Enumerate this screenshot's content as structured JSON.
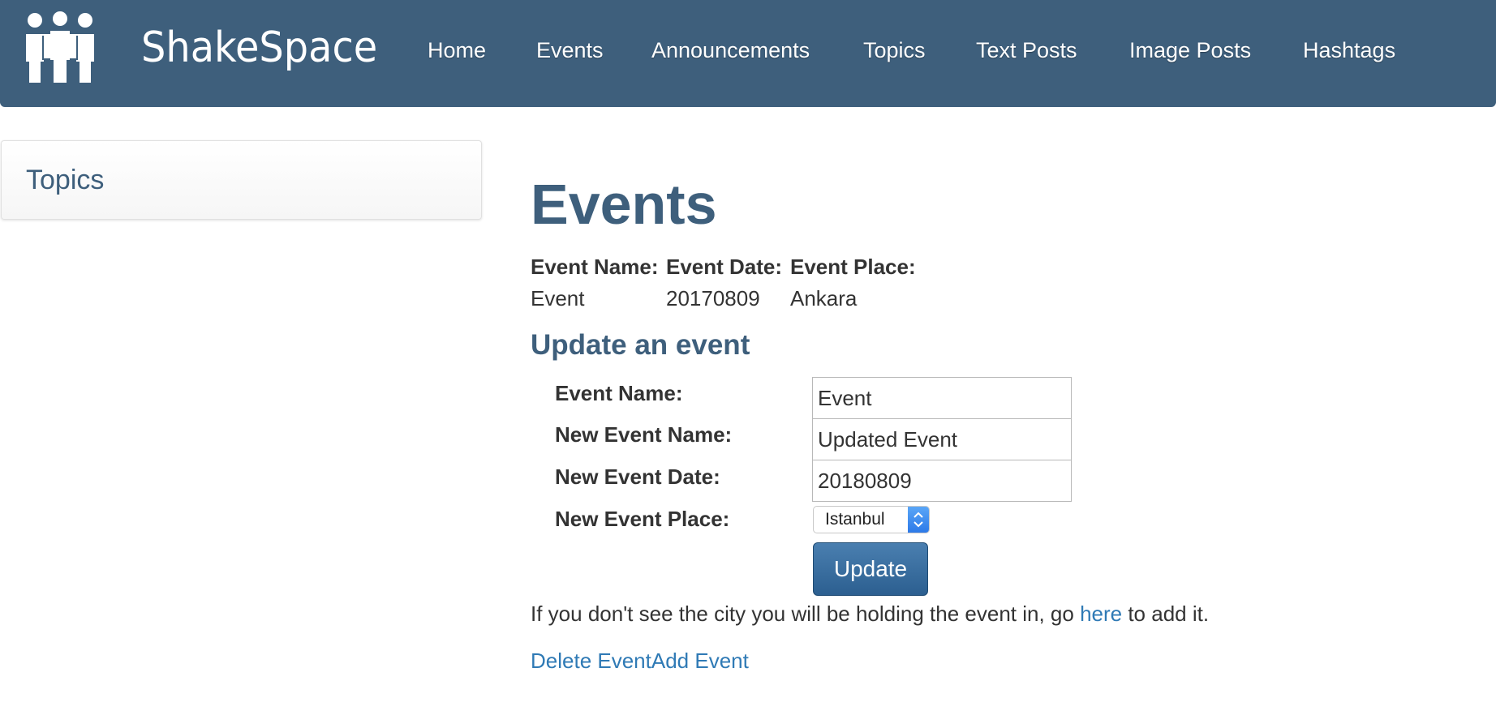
{
  "brand": {
    "name": "ShakeSpace",
    "logo_icon": "people-group-icon"
  },
  "nav": {
    "items": [
      "Home",
      "Events",
      "Announcements",
      "Topics",
      "Text Posts",
      "Image Posts",
      "Hashtags"
    ]
  },
  "sidebar": {
    "title": "Topics"
  },
  "page": {
    "title": "Events"
  },
  "events_table": {
    "headers": [
      "Event Name:",
      "Event Date:",
      "Event Place:"
    ],
    "rows": [
      [
        "Event",
        "20170809",
        "Ankara"
      ]
    ]
  },
  "update_form": {
    "title": "Update an event",
    "labels": {
      "event_name": "Event Name:",
      "new_event_name": "New Event Name:",
      "new_event_date": "New Event Date:",
      "new_event_place": "New Event Place:"
    },
    "values": {
      "event_name": "Event",
      "new_event_name": "Updated Event",
      "new_event_date": "20180809",
      "new_event_place": "Istanbul"
    },
    "submit_label": "Update"
  },
  "help": {
    "before": "If you don't see the city you will be holding the event in, go ",
    "link": "here",
    "after": " to add it."
  },
  "links": {
    "delete": "Delete Event",
    "add": "Add Event"
  },
  "colors": {
    "navbar": "#3e5f7c",
    "heading": "#3e5f7c",
    "link": "#2f7ab5",
    "button": "#2c5f90"
  }
}
